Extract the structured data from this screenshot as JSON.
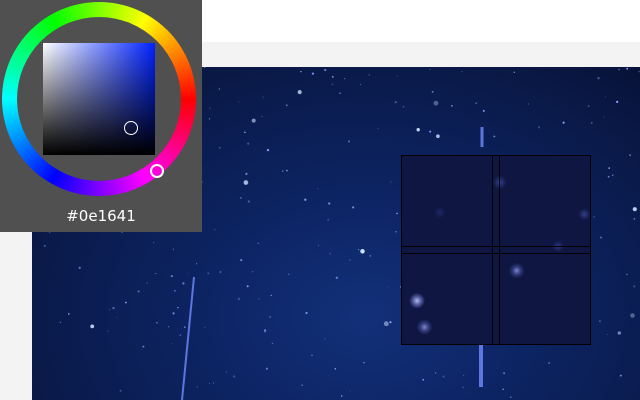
{
  "color_picker": {
    "hex_value": "#0e1641",
    "hue_color": "#0022ff",
    "panel_color": "#505050"
  },
  "colors": {
    "page_background": "#ffffff",
    "page_gray": "#f3f3f3",
    "sky_dark": "#070f30",
    "sky_mid": "#0d2463",
    "star": "#ffffff",
    "picked": "#0e1641"
  },
  "magnifier": {
    "center_color": "#0e1641"
  }
}
